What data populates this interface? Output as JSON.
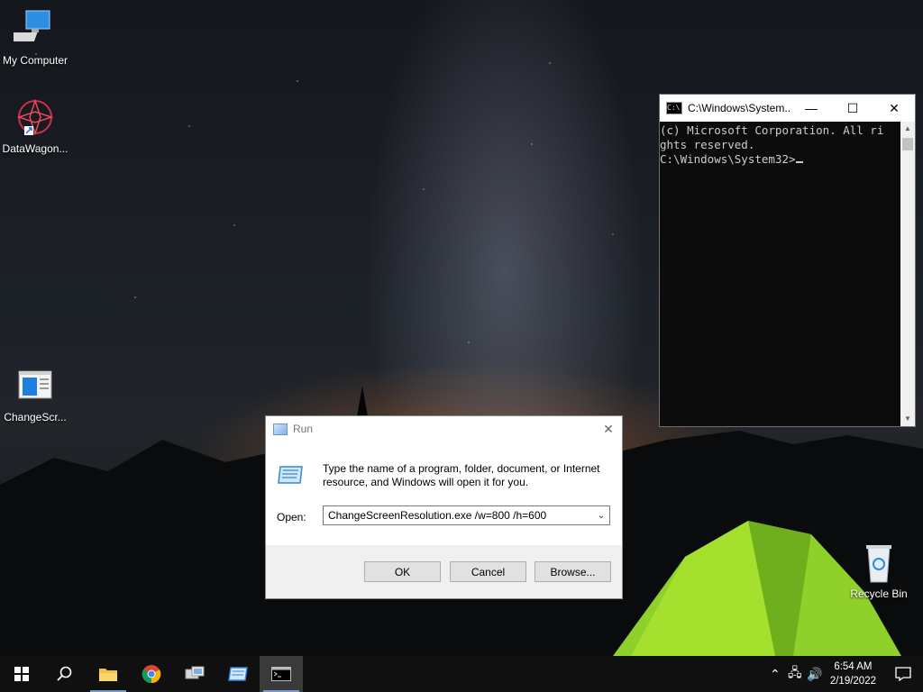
{
  "desktop": {
    "icons": [
      {
        "label": "My Computer",
        "icon": "computer-icon"
      },
      {
        "label": "DataWagon...",
        "icon": "datawagon-icon"
      },
      {
        "label": "ChangeScr...",
        "icon": "application-window-icon"
      },
      {
        "label": "Recycle Bin",
        "icon": "recycle-bin-icon"
      }
    ]
  },
  "cmd": {
    "title": "C:\\Windows\\System...",
    "lines": [
      "(c) Microsoft Corporation. All ri",
      "ghts reserved.",
      "",
      "C:\\Windows\\System32>"
    ]
  },
  "run": {
    "title": "Run",
    "description": "Type the name of a program, folder, document, or Internet resource, and Windows will open it for you.",
    "open_label": "Open:",
    "open_value": "ChangeScreenResolution.exe /w=800 /h=600",
    "ok_label": "OK",
    "cancel_label": "Cancel",
    "browse_label": "Browse..."
  },
  "taskbar": {
    "items": [
      "start-icon",
      "search-icon",
      "file-explorer-icon",
      "chrome-icon",
      "network-tool-icon",
      "run-icon",
      "command-prompt-icon"
    ],
    "time": "6:54 AM",
    "date": "2/19/2022"
  }
}
